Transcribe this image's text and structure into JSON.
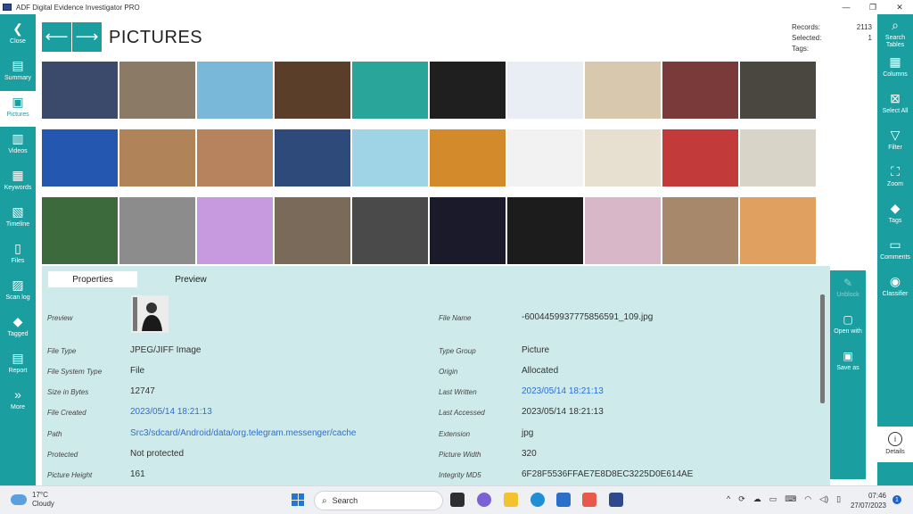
{
  "window": {
    "title": "ADF Digital Evidence Investigator PRO",
    "controls": [
      "—",
      "❐",
      "✕"
    ]
  },
  "left_nav": [
    {
      "label": "Close",
      "icon": "back-chevron-icon",
      "glyph": "❮"
    },
    {
      "label": "Summary",
      "icon": "chart-icon",
      "glyph": "▤"
    },
    {
      "label": "Pictures",
      "icon": "picture-icon",
      "glyph": "▣"
    },
    {
      "label": "Videos",
      "icon": "film-icon",
      "glyph": "▥"
    },
    {
      "label": "Keywords",
      "icon": "document-icon",
      "glyph": "▦"
    },
    {
      "label": "Timeline",
      "icon": "timeline-icon",
      "glyph": "▧"
    },
    {
      "label": "Files",
      "icon": "file-icon",
      "glyph": "▯"
    },
    {
      "label": "Scan log",
      "icon": "scan-log-icon",
      "glyph": "▨"
    },
    {
      "label": "Tagged",
      "icon": "tag-icon",
      "glyph": "◆"
    },
    {
      "label": "Report",
      "icon": "report-icon",
      "glyph": "▤"
    },
    {
      "label": "More",
      "icon": "double-chevron-icon",
      "glyph": "»"
    }
  ],
  "right_nav": [
    {
      "label": "Search Tables",
      "icon": "search-icon",
      "glyph": "⌕"
    },
    {
      "label": "Columns",
      "icon": "columns-icon",
      "glyph": "▦"
    },
    {
      "label": "Select All",
      "icon": "select-all-icon",
      "glyph": "⊠"
    },
    {
      "label": "Filter",
      "icon": "filter-icon",
      "glyph": "▽"
    },
    {
      "label": "Zoom",
      "icon": "zoom-icon",
      "glyph": "⛶"
    },
    {
      "label": "Tags",
      "icon": "tag-icon",
      "glyph": "◆"
    },
    {
      "label": "Comments",
      "icon": "comment-icon",
      "glyph": "▭"
    },
    {
      "label": "Classifier",
      "icon": "eye-icon",
      "glyph": "◉"
    }
  ],
  "header": {
    "back_glyph": "⟵",
    "forward_glyph": "⟶",
    "title": "PICTURES",
    "stats": [
      {
        "label": "Records:",
        "value": "2113"
      },
      {
        "label": "Selected:",
        "value": "1"
      },
      {
        "label": "Tags:",
        "value": ""
      }
    ]
  },
  "thumbnails": [
    {
      "color": "#3b4a6a"
    },
    {
      "color": "#8a7a66"
    },
    {
      "color": "#79b8d8"
    },
    {
      "color": "#5a3e2a"
    },
    {
      "color": "#2aa59a"
    },
    {
      "color": "#1f1f1f"
    },
    {
      "color": "#e9eef5"
    },
    {
      "color": "#d8c9ae"
    },
    {
      "color": "#7a3a3a"
    },
    {
      "color": "#4a4640"
    },
    {
      "color": "#2458b0"
    },
    {
      "color": "#b08458"
    },
    {
      "color": "#b7835e"
    },
    {
      "color": "#2e4a7a"
    },
    {
      "color": "#9ed4e6"
    },
    {
      "color": "#d38a2a"
    },
    {
      "color": "#f2f2f2"
    },
    {
      "color": "#e7dfcf"
    },
    {
      "color": "#c23a3a"
    },
    {
      "color": "#d9d4c8"
    },
    {
      "color": "#3c6a3c"
    },
    {
      "color": "#8c8c8c"
    },
    {
      "color": "#c79ae0"
    },
    {
      "color": "#7a6a5a"
    },
    {
      "color": "#4a4a4a"
    },
    {
      "color": "#1a1a2a"
    },
    {
      "color": "#1c1c1c"
    },
    {
      "color": "#d8b8c8"
    },
    {
      "color": "#a8886a"
    },
    {
      "color": "#e0a060"
    }
  ],
  "details": {
    "tabs": {
      "properties": "Properties",
      "preview": "Preview"
    },
    "left": [
      {
        "label": "Preview",
        "value": ""
      },
      {
        "label": "File Type",
        "value": "JPEG/JIFF Image"
      },
      {
        "label": "File System Type",
        "value": "File"
      },
      {
        "label": "Size in Bytes",
        "value": "12747"
      },
      {
        "label": "File Created",
        "value": "2023/05/14 18:21:13"
      },
      {
        "label": "Path",
        "value": "Src3/sdcard/Android/data/org.telegram.messenger/cache"
      },
      {
        "label": "Protected",
        "value": "Not protected"
      },
      {
        "label": "Picture Height",
        "value": "161"
      }
    ],
    "right": [
      {
        "label": "File Name",
        "value": "-6004459937775856591_109.jpg"
      },
      {
        "label": "Type Group",
        "value": "Picture"
      },
      {
        "label": "Origin",
        "value": "Allocated"
      },
      {
        "label": "Last Written",
        "value": "2023/05/14 18:21:13"
      },
      {
        "label": "Last Accessed",
        "value": "2023/05/14 18:21:13"
      },
      {
        "label": "Extension",
        "value": "jpg"
      },
      {
        "label": "Picture Width",
        "value": "320"
      },
      {
        "label": "Integrity MD5",
        "value": "6F28F5536FFAE7E8D8EC3225D0E614AE"
      }
    ]
  },
  "actions": [
    {
      "label": "Unblock",
      "icon": "unblock-icon",
      "glyph": "✎",
      "disabled": true
    },
    {
      "label": "Open with",
      "icon": "open-with-icon",
      "glyph": "▢",
      "disabled": false
    },
    {
      "label": "Save as",
      "icon": "save-icon",
      "glyph": "▣",
      "disabled": false
    }
  ],
  "details_button": {
    "label": "Details",
    "glyph": "i"
  },
  "taskbar": {
    "weather_temp": "17°C",
    "weather_desc": "Cloudy",
    "search_placeholder": "Search",
    "tray": [
      "^",
      "⟳",
      "☁",
      "▭",
      "⌨",
      "◠",
      "◁)",
      "▯"
    ],
    "time": "07:46",
    "date": "27/07/2023",
    "notification_count": "1"
  },
  "colors": {
    "accent": "#1a9ea0",
    "panel": "#cfeaea",
    "link": "#2b6fd6"
  }
}
